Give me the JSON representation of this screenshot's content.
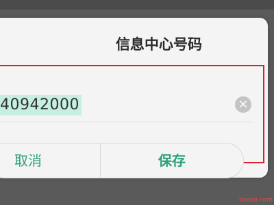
{
  "dialog": {
    "title": "信息中心号码",
    "number_value": "40942000",
    "clear_icon": "clear-circle-icon",
    "cancel_label": "取消",
    "save_label": "保存"
  },
  "colors": {
    "accent": "#2ba07a",
    "highlight_frame": "#d6222e",
    "selection": "#c6efe1"
  },
  "watermark": {
    "text": "booso.com"
  }
}
